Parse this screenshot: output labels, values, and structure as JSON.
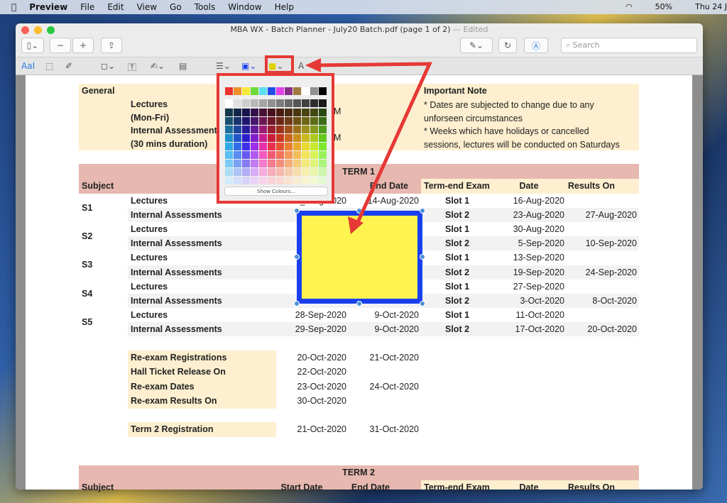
{
  "menubar": {
    "app": "Preview",
    "items": [
      "File",
      "Edit",
      "View",
      "Go",
      "Tools",
      "Window",
      "Help"
    ],
    "battery": "50%",
    "clock": "Thu 24 J"
  },
  "window": {
    "title": "MBA WX - Batch Planner - July20 Batch.pdf (page 1 of 2)",
    "edited": "— Edited",
    "search_placeholder": "Search"
  },
  "colors": {
    "accent_red": "#e53935",
    "fill": "#fff44f",
    "border": "#1a3ff0",
    "pink": "#e6b8b0",
    "beige": "#fdefcf",
    "grey_row": "#f2f2f2"
  },
  "palette": {
    "top_row": [
      "#e8322d",
      "#f0902d",
      "#f5ea3a",
      "#6cdc3a",
      "#5ee0f0",
      "#1f4fe8",
      "#e040e8",
      "#8a2d8a",
      "#a07a40",
      "#ffffff",
      "#909090",
      "#000000"
    ],
    "show_colours": "Show Colours..."
  },
  "general": {
    "label": "General",
    "lines": [
      "Lectures",
      "(Mon-Fri)",
      "Internal Assessments",
      "(30 mins duration)"
    ],
    "partial": [
      "M",
      "M"
    ],
    "note_title": "Important Note",
    "note_lines": [
      "* Dates are subjected to change due to any",
      "unforseen circumstances",
      "* Weeks which have holidays or cancelled",
      "sessions, lectures will be conducted on Saturdays"
    ]
  },
  "term1": {
    "title": "TERM 1",
    "headers": {
      "subject": "Subject",
      "end": "End Date",
      "exam": "Term-end Exam",
      "date": "Date",
      "results": "Results On"
    },
    "subjects": [
      "S1",
      "S2",
      "S3",
      "S4",
      "S5"
    ],
    "rows": [
      {
        "activity": "Lectures",
        "start": "_-Aug-2020",
        "end": "14-Aug-2020",
        "slot": "Slot 1",
        "date": "16-Aug-2020",
        "results": ""
      },
      {
        "activity": "Internal Assessments",
        "start": "",
        "end": "",
        "slot": "Slot 2",
        "date": "23-Aug-2020",
        "results": "27-Aug-2020"
      },
      {
        "activity": "Lectures",
        "start": "",
        "end": "",
        "slot": "Slot 1",
        "date": "30-Aug-2020",
        "results": ""
      },
      {
        "activity": "Internal Assessments",
        "start": "",
        "end": "",
        "slot": "Slot 2",
        "date": "5-Sep-2020",
        "results": "10-Sep-2020"
      },
      {
        "activity": "Lectures",
        "start": "",
        "end": "",
        "slot": "Slot 1",
        "date": "13-Sep-2020",
        "results": ""
      },
      {
        "activity": "Internal Assessments",
        "start": "",
        "end": "",
        "slot": "Slot 2",
        "date": "19-Sep-2020",
        "results": "24-Sep-2020"
      },
      {
        "activity": "Lectures",
        "start": "",
        "end": "",
        "slot": "Slot 1",
        "date": "27-Sep-2020",
        "results": ""
      },
      {
        "activity": "Internal Assessments",
        "start": "",
        "end": "",
        "slot": "Slot 2",
        "date": "3-Oct-2020",
        "results": "8-Oct-2020"
      },
      {
        "activity": "Lectures",
        "start": "28-Sep-2020",
        "end": "9-Oct-2020",
        "slot": "Slot 1",
        "date": "11-Oct-2020",
        "results": ""
      },
      {
        "activity": "Internal Assessments",
        "start": "29-Sep-2020",
        "end": "9-Oct-2020",
        "slot": "Slot 2",
        "date": "17-Oct-2020",
        "results": "20-Oct-2020"
      }
    ]
  },
  "reexam": [
    {
      "label": "Re-exam Registrations",
      "start": "20-Oct-2020",
      "end": "21-Oct-2020"
    },
    {
      "label": "Hall Ticket Release On",
      "start": "22-Oct-2020",
      "end": ""
    },
    {
      "label": "Re-exam Dates",
      "start": "23-Oct-2020",
      "end": "24-Oct-2020"
    },
    {
      "label": "Re-exam Results On",
      "start": "30-Oct-2020",
      "end": ""
    }
  ],
  "term2_reg": {
    "label": "Term 2 Registration",
    "start": "21-Oct-2020",
    "end": "31-Oct-2020"
  },
  "term2": {
    "title": "TERM 2",
    "headers": {
      "subject": "Subject",
      "start": "Start Date",
      "end": "End Date",
      "exam": "Term-end Exam",
      "date": "Date",
      "results": "Results On"
    }
  }
}
